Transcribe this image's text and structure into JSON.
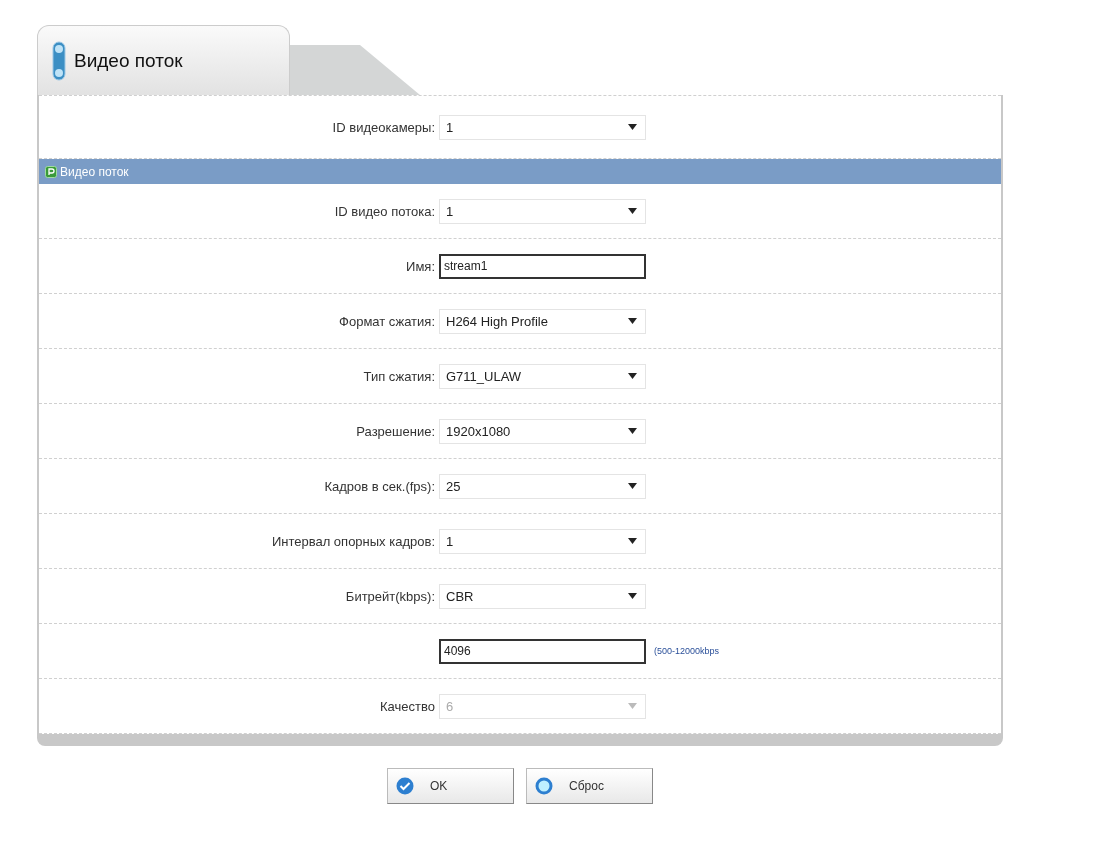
{
  "tab": {
    "label": "Видео поток",
    "selected": true
  },
  "camera": {
    "label": "ID видеокамеры:",
    "value": "1"
  },
  "section": {
    "title": "Видео поток"
  },
  "fields": [
    {
      "kind": "select",
      "label": "ID видео потока:",
      "value": "1",
      "disabled": false
    },
    {
      "kind": "text",
      "label": "Имя:",
      "value": "stream1"
    },
    {
      "kind": "select",
      "label": "Формат сжатия:",
      "value": "H264 High Profile",
      "disabled": false
    },
    {
      "kind": "select",
      "label": "Тип сжатия:",
      "value": "G711_ULAW",
      "disabled": false
    },
    {
      "kind": "select",
      "label": "Разрешение:",
      "value": "1920x1080",
      "disabled": false
    },
    {
      "kind": "select",
      "label": "Кадров в сек.(fps):",
      "value": "25",
      "disabled": false
    },
    {
      "kind": "select",
      "label": "Интервал опорных кадров:",
      "value": "1",
      "disabled": false
    },
    {
      "kind": "select",
      "label": "Битрейт(kbps):",
      "value": "CBR",
      "disabled": false
    },
    {
      "kind": "text",
      "value": "4096",
      "hint": "(500-12000kbps"
    },
    {
      "kind": "select",
      "label": "Качество",
      "value": "6",
      "disabled": true
    }
  ],
  "buttons": [
    {
      "kind": "ok",
      "label": "OK"
    },
    {
      "kind": "reset",
      "label": "Сброс"
    }
  ]
}
